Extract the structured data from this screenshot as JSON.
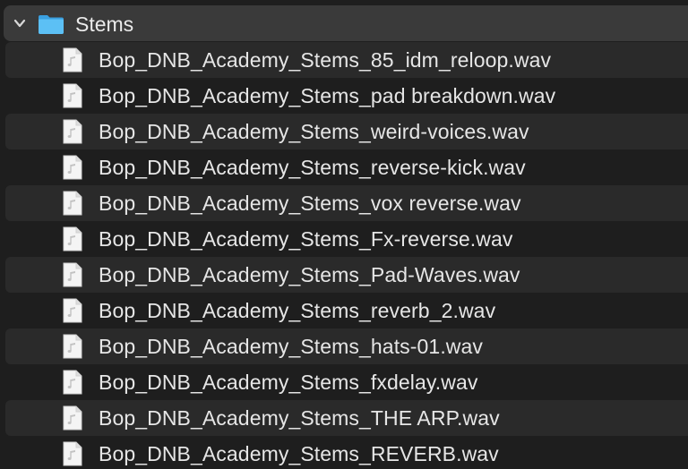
{
  "folder": {
    "name": "Stems",
    "expanded": true,
    "icon": "folder-icon",
    "color": "#4fb4f0"
  },
  "files": [
    {
      "name": "Bop_DNB_Academy_Stems_85_idm_reloop.wav",
      "icon": "audio-file-icon"
    },
    {
      "name": "Bop_DNB_Academy_Stems_pad breakdown.wav",
      "icon": "audio-file-icon"
    },
    {
      "name": "Bop_DNB_Academy_Stems_weird-voices.wav",
      "icon": "audio-file-icon"
    },
    {
      "name": "Bop_DNB_Academy_Stems_reverse-kick.wav",
      "icon": "audio-file-icon"
    },
    {
      "name": "Bop_DNB_Academy_Stems_vox reverse.wav",
      "icon": "audio-file-icon"
    },
    {
      "name": "Bop_DNB_Academy_Stems_Fx-reverse.wav",
      "icon": "audio-file-icon"
    },
    {
      "name": "Bop_DNB_Academy_Stems_Pad-Waves.wav",
      "icon": "audio-file-icon"
    },
    {
      "name": "Bop_DNB_Academy_Stems_reverb_2.wav",
      "icon": "audio-file-icon"
    },
    {
      "name": "Bop_DNB_Academy_Stems_hats-01.wav",
      "icon": "audio-file-icon"
    },
    {
      "name": "Bop_DNB_Academy_Stems_fxdelay.wav",
      "icon": "audio-file-icon"
    },
    {
      "name": "Bop_DNB_Academy_Stems_THE ARP.wav",
      "icon": "audio-file-icon"
    },
    {
      "name": "Bop_DNB_Academy_Stems_REVERB.wav",
      "icon": "audio-file-icon"
    }
  ],
  "colors": {
    "background": "#1e1e1e",
    "alternate_row": "#2a2a2a",
    "selected_folder_row": "#3a3a3a",
    "text": "#e6e6e6"
  }
}
